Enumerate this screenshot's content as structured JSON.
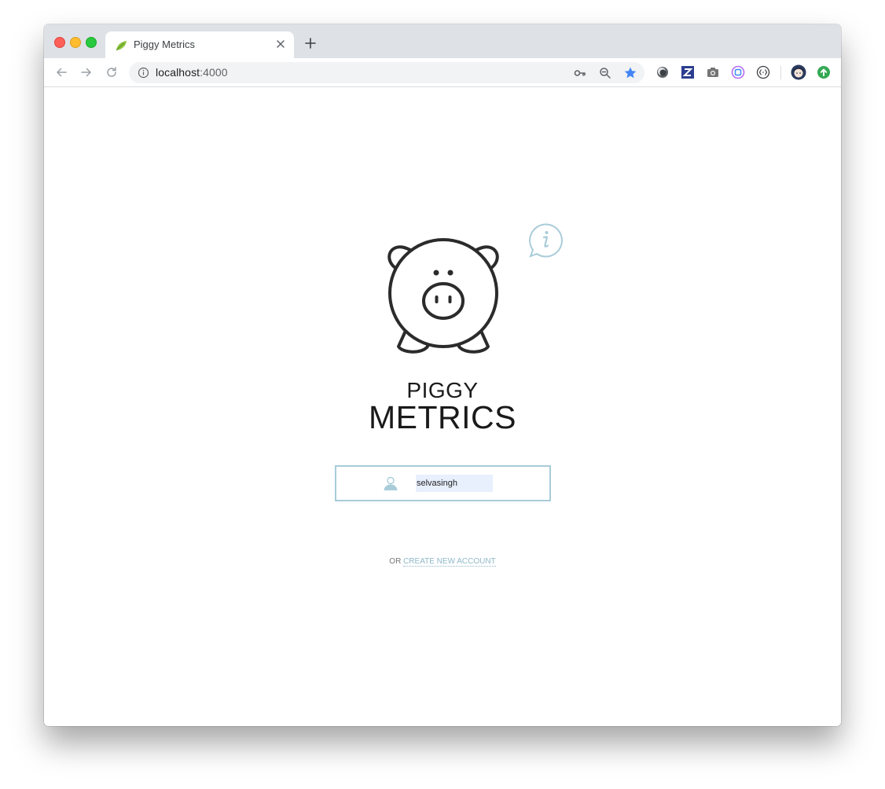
{
  "browser": {
    "tab": {
      "title": "Piggy Metrics",
      "favicon": "leaf-icon"
    },
    "address_bar": {
      "host": "localhost",
      "port": ":4000"
    },
    "icons": [
      "back-icon",
      "forward-icon",
      "reload-icon",
      "info-icon",
      "key-icon",
      "zoom-out-icon",
      "bookmark-star-icon",
      "extension-circle-icon",
      "extension-z-icon",
      "camera-icon",
      "extension-square-icon",
      "extension-brackets-icon",
      "profile-avatar-icon",
      "update-arrow-icon"
    ],
    "colors": {
      "star": "#4285f4",
      "z_extension": "#2c3e8f",
      "update_badge": "#34a853"
    }
  },
  "app": {
    "brand_line1": "PIGGY",
    "brand_line2": "METRICS",
    "login": {
      "username_value": "selvasingh"
    },
    "footer": {
      "or_text": "OR",
      "create_account_label": "CREATE NEW ACCOUNT"
    },
    "colors": {
      "accent": "#a9ccd9",
      "link": "#8fb8c8",
      "autofill": "#e8f0fe"
    }
  }
}
